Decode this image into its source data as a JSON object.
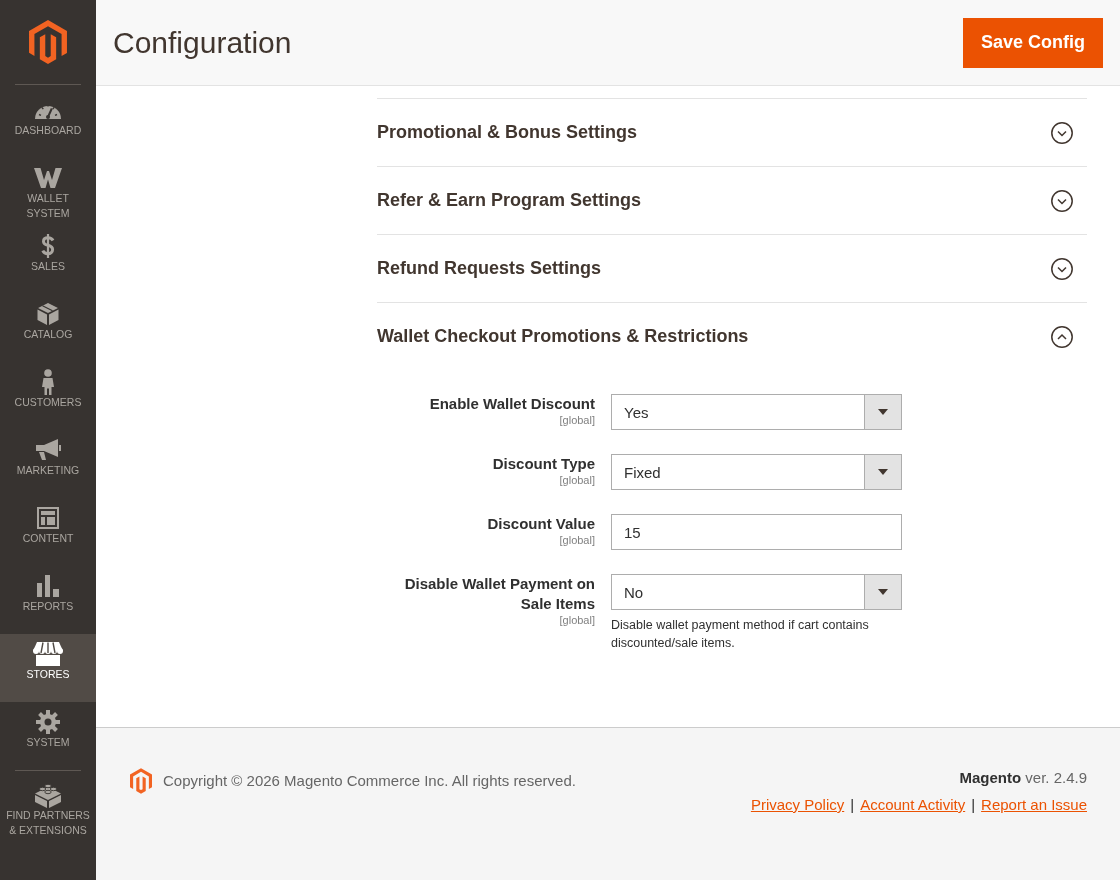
{
  "sidebar": {
    "items": [
      {
        "label": "DASHBOARD",
        "selected": false
      },
      {
        "label": "WALLET SYSTEM",
        "selected": false
      },
      {
        "label": "SALES",
        "selected": false
      },
      {
        "label": "CATALOG",
        "selected": false
      },
      {
        "label": "CUSTOMERS",
        "selected": false
      },
      {
        "label": "MARKETING",
        "selected": false
      },
      {
        "label": "CONTENT",
        "selected": false
      },
      {
        "label": "REPORTS",
        "selected": false
      },
      {
        "label": "STORES",
        "selected": true
      },
      {
        "label": "SYSTEM",
        "selected": false
      },
      {
        "label": "FIND PARTNERS & EXTENSIONS",
        "selected": false
      }
    ]
  },
  "header": {
    "title": "Configuration",
    "save_button": "Save Config"
  },
  "sections": [
    {
      "title": "Promotional & Bonus Settings",
      "expanded": false
    },
    {
      "title": "Refer & Earn Program Settings",
      "expanded": false
    },
    {
      "title": "Refund Requests Settings",
      "expanded": false
    },
    {
      "title": "Wallet Checkout Promotions & Restrictions",
      "expanded": true,
      "fields": [
        {
          "kind": "select",
          "label": "Enable Wallet Discount",
          "scope": "[global]",
          "value": "Yes"
        },
        {
          "kind": "select",
          "label": "Discount Type",
          "scope": "[global]",
          "value": "Fixed"
        },
        {
          "kind": "text",
          "label": "Discount Value",
          "scope": "[global]",
          "value": "15"
        },
        {
          "kind": "select",
          "label": "Disable Wallet Payment on Sale Items",
          "scope": "[global]",
          "value": "No",
          "note": "Disable wallet payment method if cart contains discounted/sale items."
        }
      ]
    }
  ],
  "footer": {
    "copyright": "Copyright © 2026 Magento Commerce Inc. All rights reserved.",
    "version": "**Magento** ver. 2.4.9",
    "links": [
      "Privacy Policy",
      "Account Activity",
      "Report an Issue"
    ],
    "separators": [
      "|",
      "|"
    ]
  }
}
